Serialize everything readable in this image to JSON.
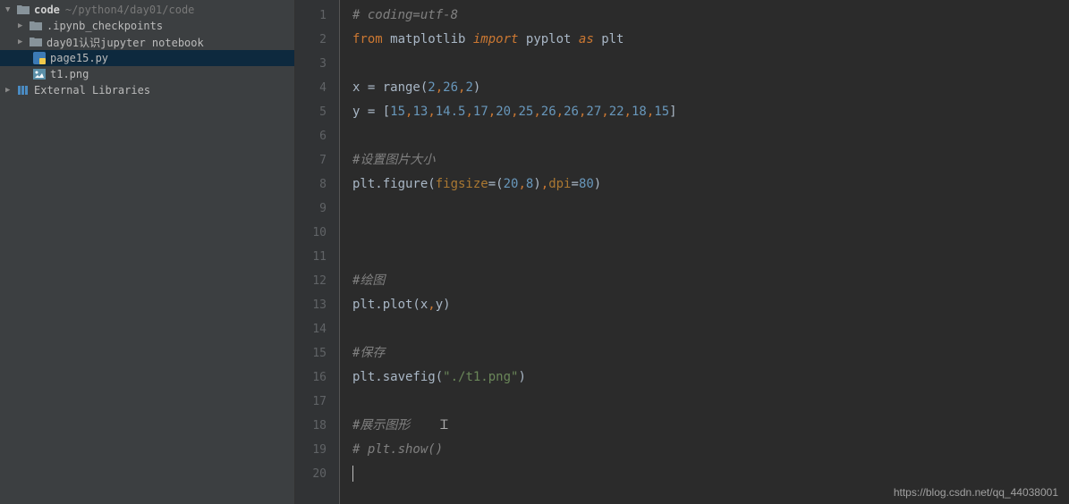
{
  "sidebar": {
    "root": {
      "name": "code",
      "path": "~/python4/day01/code"
    },
    "items": [
      {
        "name": ".ipynb_checkpoints",
        "type": "folder"
      },
      {
        "name": "day01认识jupyter notebook",
        "type": "folder"
      },
      {
        "name": "page15.py",
        "type": "python"
      },
      {
        "name": "t1.png",
        "type": "image"
      }
    ],
    "external": "External Libraries"
  },
  "editor": {
    "lines": [
      {
        "n": "1",
        "tokens": [
          {
            "t": "# coding=utf-8",
            "c": "c-comment"
          }
        ]
      },
      {
        "n": "2",
        "tokens": [
          {
            "t": "from ",
            "c": "c-keyword"
          },
          {
            "t": "matplotlib ",
            "c": "c-default"
          },
          {
            "t": "import ",
            "c": "c-keyword c-italic"
          },
          {
            "t": "pyplot ",
            "c": "c-default"
          },
          {
            "t": "as ",
            "c": "c-keyword c-italic"
          },
          {
            "t": "plt",
            "c": "c-default"
          }
        ]
      },
      {
        "n": "3",
        "tokens": []
      },
      {
        "n": "4",
        "tokens": [
          {
            "t": "x = range(",
            "c": "c-default"
          },
          {
            "t": "2",
            "c": "c-number"
          },
          {
            "t": ",",
            "c": "c-keyword"
          },
          {
            "t": "26",
            "c": "c-number"
          },
          {
            "t": ",",
            "c": "c-keyword"
          },
          {
            "t": "2",
            "c": "c-number"
          },
          {
            "t": ")",
            "c": "c-default"
          }
        ]
      },
      {
        "n": "5",
        "tokens": [
          {
            "t": "y = [",
            "c": "c-default"
          },
          {
            "t": "15",
            "c": "c-number"
          },
          {
            "t": ",",
            "c": "c-keyword"
          },
          {
            "t": "13",
            "c": "c-number"
          },
          {
            "t": ",",
            "c": "c-keyword"
          },
          {
            "t": "14.5",
            "c": "c-number"
          },
          {
            "t": ",",
            "c": "c-keyword"
          },
          {
            "t": "17",
            "c": "c-number"
          },
          {
            "t": ",",
            "c": "c-keyword"
          },
          {
            "t": "20",
            "c": "c-number"
          },
          {
            "t": ",",
            "c": "c-keyword"
          },
          {
            "t": "25",
            "c": "c-number"
          },
          {
            "t": ",",
            "c": "c-keyword"
          },
          {
            "t": "26",
            "c": "c-number"
          },
          {
            "t": ",",
            "c": "c-keyword"
          },
          {
            "t": "26",
            "c": "c-number"
          },
          {
            "t": ",",
            "c": "c-keyword"
          },
          {
            "t": "27",
            "c": "c-number"
          },
          {
            "t": ",",
            "c": "c-keyword"
          },
          {
            "t": "22",
            "c": "c-number"
          },
          {
            "t": ",",
            "c": "c-keyword"
          },
          {
            "t": "18",
            "c": "c-number"
          },
          {
            "t": ",",
            "c": "c-keyword"
          },
          {
            "t": "15",
            "c": "c-number"
          },
          {
            "t": "]",
            "c": "c-default"
          }
        ]
      },
      {
        "n": "6",
        "tokens": []
      },
      {
        "n": "7",
        "tokens": [
          {
            "t": "#设置图片大小",
            "c": "c-comment"
          }
        ]
      },
      {
        "n": "8",
        "tokens": [
          {
            "t": "plt.figure(",
            "c": "c-default"
          },
          {
            "t": "figsize",
            "c": "c-param"
          },
          {
            "t": "=(",
            "c": "c-default"
          },
          {
            "t": "20",
            "c": "c-number"
          },
          {
            "t": ",",
            "c": "c-keyword"
          },
          {
            "t": "8",
            "c": "c-number"
          },
          {
            "t": ")",
            "c": "c-default"
          },
          {
            "t": ",",
            "c": "c-keyword"
          },
          {
            "t": "dpi",
            "c": "c-param"
          },
          {
            "t": "=",
            "c": "c-default"
          },
          {
            "t": "80",
            "c": "c-number"
          },
          {
            "t": ")",
            "c": "c-default"
          }
        ]
      },
      {
        "n": "9",
        "tokens": []
      },
      {
        "n": "10",
        "tokens": []
      },
      {
        "n": "11",
        "tokens": []
      },
      {
        "n": "12",
        "tokens": [
          {
            "t": "#绘图",
            "c": "c-comment"
          }
        ]
      },
      {
        "n": "13",
        "tokens": [
          {
            "t": "plt.plot(x",
            "c": "c-default"
          },
          {
            "t": ",",
            "c": "c-keyword"
          },
          {
            "t": "y)",
            "c": "c-default"
          }
        ]
      },
      {
        "n": "14",
        "tokens": []
      },
      {
        "n": "15",
        "tokens": [
          {
            "t": "#保存",
            "c": "c-comment"
          }
        ]
      },
      {
        "n": "16",
        "tokens": [
          {
            "t": "plt.savefig(",
            "c": "c-default"
          },
          {
            "t": "\"./t1.png\"",
            "c": "c-string"
          },
          {
            "t": ")",
            "c": "c-default"
          }
        ]
      },
      {
        "n": "17",
        "tokens": []
      },
      {
        "n": "18",
        "tokens": [
          {
            "t": "#展示图形",
            "c": "c-comment"
          }
        ]
      },
      {
        "n": "19",
        "tokens": [
          {
            "t": "# plt.show()",
            "c": "c-comment"
          }
        ]
      },
      {
        "n": "20",
        "tokens": []
      }
    ]
  },
  "watermark": "https://blog.csdn.net/qq_44038001"
}
